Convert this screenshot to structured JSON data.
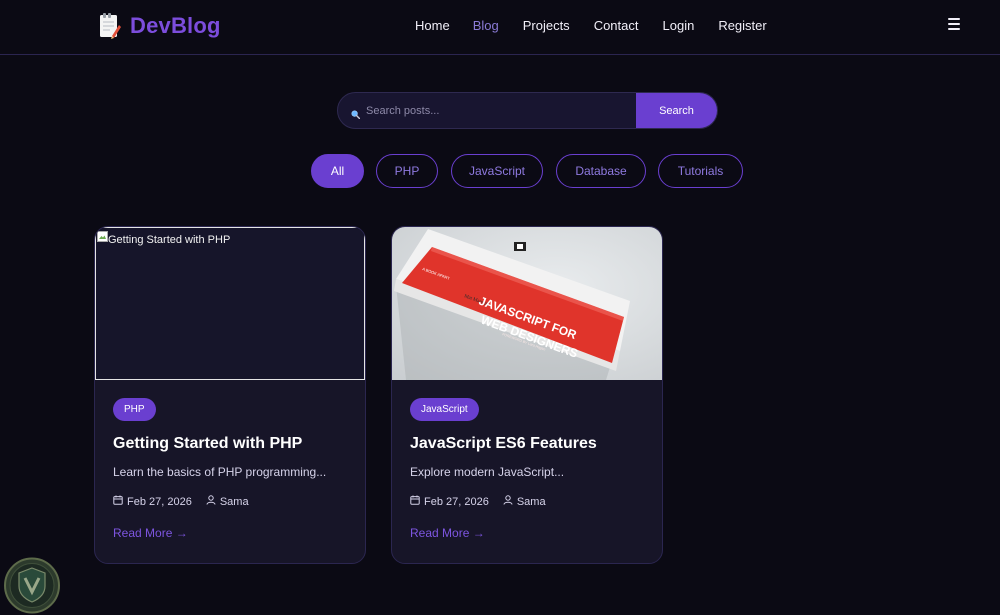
{
  "brand": {
    "title": "DevBlog",
    "icon": "notepad-pencil-icon",
    "accent": "#7c4ddc"
  },
  "nav": {
    "items": [
      {
        "label": "Home"
      },
      {
        "label": "Blog",
        "active": true
      },
      {
        "label": "Projects"
      },
      {
        "label": "Contact"
      },
      {
        "label": "Login"
      },
      {
        "label": "Register"
      }
    ],
    "menu_icon": "hamburger-icon"
  },
  "search": {
    "placeholder": "Search posts...",
    "button_label": "Search"
  },
  "filters": [
    {
      "label": "All",
      "active": true
    },
    {
      "label": "PHP"
    },
    {
      "label": "JavaScript"
    },
    {
      "label": "Database"
    },
    {
      "label": "Tutorials"
    }
  ],
  "posts": [
    {
      "image_alt": "Getting Started with PHP",
      "tag": "PHP",
      "title": "Getting Started with PHP",
      "excerpt": "Learn the basics of PHP programming...",
      "date": "Feb 27, 2026",
      "author": "Sama",
      "read_more": "Read More →"
    },
    {
      "image_alt": "JavaScript ES6 Features",
      "tag": "JavaScript",
      "title": "JavaScript ES6 Features",
      "excerpt": "Explore modern JavaScript...",
      "date": "Feb 27, 2026",
      "author": "Sama",
      "read_more": "Read More →",
      "book_cover": {
        "publisher": "A BOOK APART",
        "author": "Mat Marquis",
        "title_line1": "JAVASCRIPT FOR",
        "title_line2": "WEB DESIGNERS",
        "foreword": "FOREWORD BY Lara Hogan"
      }
    }
  ],
  "colors": {
    "background": "#0b0a14",
    "primary": "#6a3fd0",
    "card": "#171528"
  }
}
